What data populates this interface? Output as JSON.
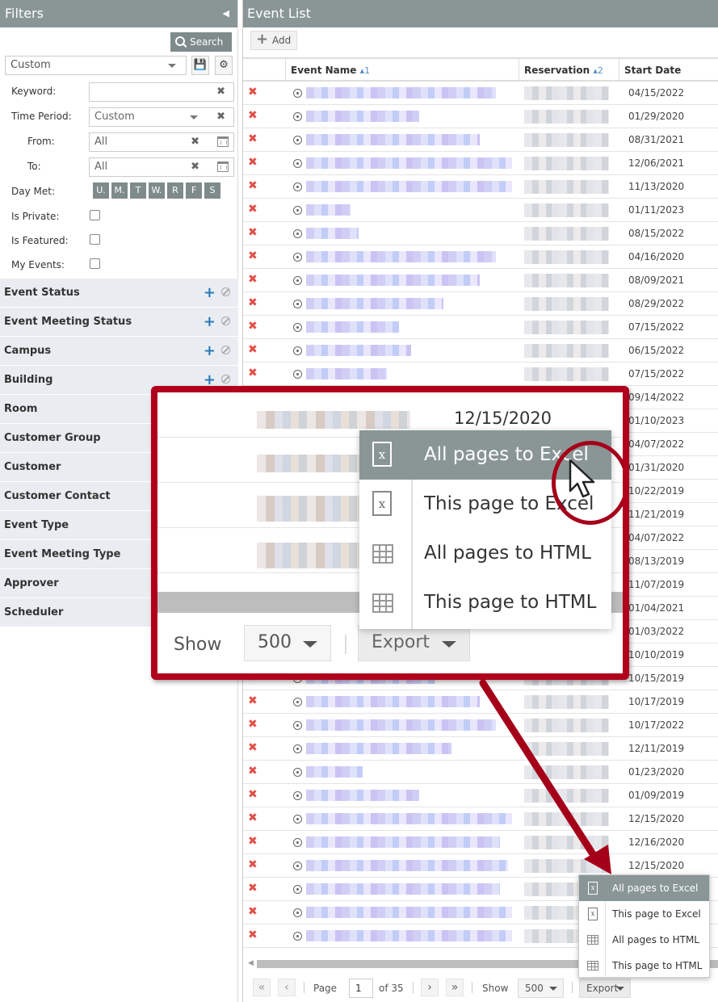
{
  "filters": {
    "title": "Filters",
    "search_label": "Search",
    "preset_value": "Custom",
    "fields": {
      "keyword": {
        "label": "Keyword:",
        "value": ""
      },
      "time_period": {
        "label": "Time Period:",
        "value": "Custom"
      },
      "from": {
        "label": "From:",
        "value": "All"
      },
      "to": {
        "label": "To:",
        "value": "All"
      },
      "day_met": {
        "label": "Day Met:",
        "days": [
          "U.",
          "M.",
          "T",
          "W.",
          "R",
          "F",
          "S"
        ]
      },
      "is_private": {
        "label": "Is Private:",
        "checked": false
      },
      "is_featured": {
        "label": "Is Featured:",
        "checked": false
      },
      "my_events": {
        "label": "My Events:",
        "checked": false
      }
    },
    "categories": [
      {
        "label": "Event Status",
        "has_actions": true
      },
      {
        "label": "Event Meeting Status",
        "has_actions": true
      },
      {
        "label": "Campus",
        "has_actions": true
      },
      {
        "label": "Building",
        "has_actions": true
      },
      {
        "label": "Room",
        "has_actions": false
      },
      {
        "label": "Customer Group",
        "has_actions": false
      },
      {
        "label": "Customer",
        "has_actions": false
      },
      {
        "label": "Customer Contact",
        "has_actions": false
      },
      {
        "label": "Event Type",
        "has_actions": false
      },
      {
        "label": "Event Meeting Type",
        "has_actions": false
      },
      {
        "label": "Approver",
        "has_actions": false
      },
      {
        "label": "Scheduler",
        "has_actions": false
      }
    ]
  },
  "event_list": {
    "title": "Event List",
    "add_label": "Add",
    "columns": [
      {
        "label": "Event Name",
        "sort": "▴1"
      },
      {
        "label": "Reservation",
        "sort": "▴2"
      },
      {
        "label": "Start Date",
        "sort": ""
      }
    ],
    "rows": [
      {
        "name_redacted": true,
        "reservation_redacted": true,
        "start_date": "04/15/2022"
      },
      {
        "name_redacted": true,
        "reservation_redacted": true,
        "start_date": "01/29/2020"
      },
      {
        "name_redacted": true,
        "reservation_redacted": true,
        "start_date": "08/31/2021"
      },
      {
        "name_redacted": true,
        "reservation_redacted": true,
        "start_date": "12/06/2021"
      },
      {
        "name_redacted": true,
        "reservation_redacted": true,
        "start_date": "11/13/2020"
      },
      {
        "name_redacted": true,
        "reservation_redacted": true,
        "start_date": "01/11/2023"
      },
      {
        "name_redacted": true,
        "reservation_redacted": true,
        "start_date": "08/15/2022"
      },
      {
        "name_redacted": true,
        "reservation_redacted": true,
        "start_date": "04/16/2020"
      },
      {
        "name_redacted": true,
        "reservation_redacted": true,
        "start_date": "08/09/2021"
      },
      {
        "name_redacted": true,
        "reservation_redacted": true,
        "start_date": "08/29/2022"
      },
      {
        "name_redacted": true,
        "reservation_redacted": true,
        "start_date": "07/15/2022"
      },
      {
        "name_redacted": true,
        "reservation_redacted": true,
        "start_date": "06/15/2022"
      },
      {
        "name_redacted": true,
        "reservation_redacted": true,
        "start_date": "07/15/2022"
      },
      {
        "name_redacted": true,
        "reservation_redacted": true,
        "start_date": "09/14/2022"
      },
      {
        "name_redacted": true,
        "reservation_redacted": true,
        "start_date": "01/10/2023"
      },
      {
        "name_redacted": true,
        "reservation_redacted": true,
        "start_date": "04/07/2022"
      },
      {
        "name_redacted": true,
        "reservation_redacted": true,
        "start_date": "01/31/2020"
      },
      {
        "name_redacted": true,
        "reservation_redacted": true,
        "start_date": "10/22/2019"
      },
      {
        "name_redacted": true,
        "reservation_redacted": true,
        "start_date": "11/21/2019"
      },
      {
        "name_redacted": true,
        "reservation_redacted": true,
        "start_date": "04/07/2022"
      },
      {
        "name_redacted": true,
        "reservation_redacted": true,
        "start_date": "08/13/2019"
      },
      {
        "name_redacted": true,
        "reservation_redacted": true,
        "start_date": "11/07/2019"
      },
      {
        "name_redacted": true,
        "reservation_redacted": true,
        "start_date": "01/04/2021"
      },
      {
        "name_redacted": true,
        "reservation_redacted": true,
        "start_date": "01/03/2022"
      },
      {
        "name_redacted": true,
        "reservation_redacted": true,
        "start_date": "10/10/2019"
      },
      {
        "name_redacted": true,
        "reservation_redacted": true,
        "start_date": "10/15/2019"
      },
      {
        "name_redacted": true,
        "reservation_redacted": true,
        "start_date": "10/17/2019"
      },
      {
        "name_redacted": true,
        "reservation_redacted": true,
        "start_date": "10/17/2022"
      },
      {
        "name_redacted": true,
        "reservation_redacted": true,
        "start_date": "12/11/2019"
      },
      {
        "name_redacted": true,
        "reservation_redacted": true,
        "start_date": "01/23/2020"
      },
      {
        "name_redacted": true,
        "reservation_redacted": true,
        "start_date": "01/09/2019"
      },
      {
        "name_redacted": true,
        "reservation_redacted": true,
        "start_date": "12/15/2020"
      },
      {
        "name_redacted": true,
        "reservation_redacted": true,
        "start_date": "12/16/2020"
      },
      {
        "name_redacted": true,
        "reservation_redacted": true,
        "start_date": "12/15/2020"
      },
      {
        "name_redacted": true,
        "reservation_redacted": true,
        "start_date": ""
      },
      {
        "name_redacted": true,
        "reservation_redacted": true,
        "start_date": ""
      },
      {
        "name_redacted": true,
        "reservation_redacted": true,
        "start_date": ""
      }
    ],
    "pager": {
      "page_label": "Page",
      "current_page": "1",
      "of_label": "of 35",
      "show_label": "Show",
      "page_size": "500",
      "export_label": "Export"
    },
    "export_menu": [
      {
        "label": "All pages to Excel",
        "icon": "excel-file-icon",
        "active": true
      },
      {
        "label": "This page to Excel",
        "icon": "excel-file-icon",
        "active": false
      },
      {
        "label": "All pages to HTML",
        "icon": "html-table-icon",
        "active": false
      },
      {
        "label": "This page to HTML",
        "icon": "html-table-icon",
        "active": false
      }
    ]
  },
  "callout": {
    "date": "12/15/2020",
    "show_label": "Show",
    "page_size": "500",
    "export_label": "Export"
  },
  "colors": {
    "header_bg": "#8a9696",
    "accent_red": "#b1001c",
    "delete_red": "#e0504a",
    "plus_blue": "#2a7ab8"
  }
}
